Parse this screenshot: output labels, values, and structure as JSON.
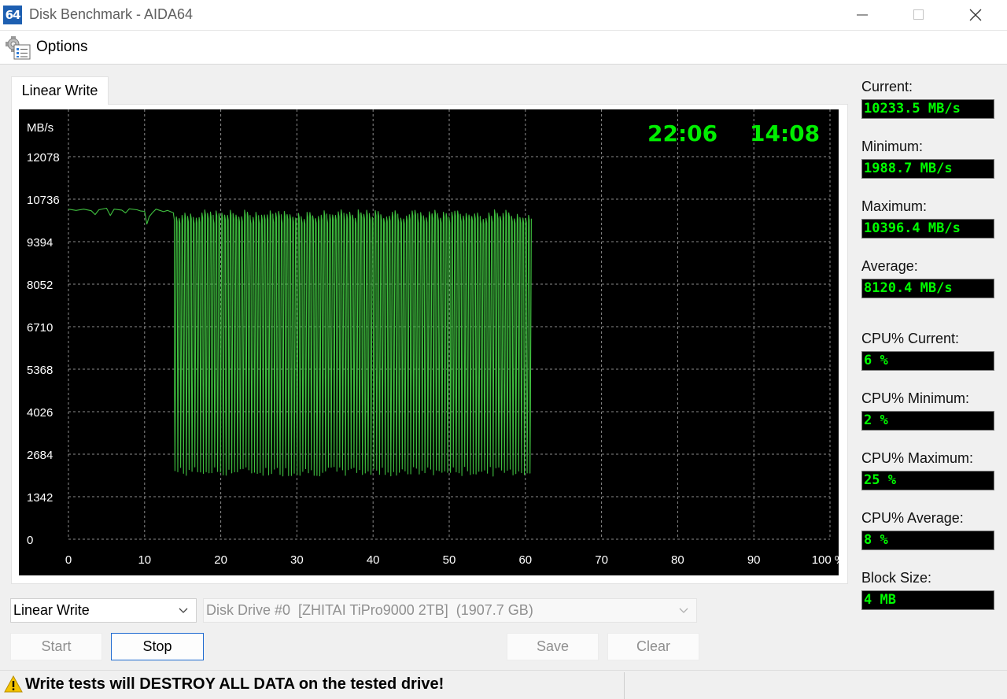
{
  "window": {
    "app_icon_text": "64",
    "title": "Disk Benchmark - AIDA64"
  },
  "menu": {
    "options_label": "Options"
  },
  "tab": {
    "label": "Linear Write"
  },
  "chart_data": {
    "type": "line",
    "ylabel": "MB/s",
    "ylim": [
      0,
      12078
    ],
    "yticks": [
      "0",
      "1342",
      "2684",
      "4026",
      "5368",
      "6710",
      "8052",
      "9394",
      "10736",
      "12078"
    ],
    "xlim": [
      0,
      100
    ],
    "xticks": [
      "0",
      "10",
      "20",
      "30",
      "40",
      "50",
      "60",
      "70",
      "80",
      "90",
      "100 %"
    ],
    "grid": true,
    "colors": {
      "background": "#000000",
      "grid": "#8c8c8c",
      "line": "#3fbf3f",
      "text": "#ffffff",
      "timer": "#00ee00"
    },
    "time_elapsed": "22:06",
    "time_remaining": "14:08",
    "series": [
      {
        "stable_phase": {
          "x": [
            0,
            1,
            2,
            3,
            3.5,
            4,
            5,
            5.5,
            6,
            7,
            7.5,
            8,
            9,
            9.5,
            10,
            10.3,
            10.6,
            11,
            11.5,
            12,
            12.5,
            13,
            13.5,
            13.8
          ],
          "y": [
            10420,
            10380,
            10420,
            10370,
            10250,
            10400,
            10450,
            10220,
            10420,
            10390,
            10300,
            10430,
            10400,
            10360,
            10350,
            9950,
            10180,
            10300,
            10420,
            10380,
            10340,
            10380,
            10330,
            10300
          ]
        },
        "oscillation_phase": {
          "x_start": 13.8,
          "x_end": 60.8,
          "cycles": 126,
          "high": [
            10100,
            10400
          ],
          "low": [
            1988.7,
            2300
          ],
          "mid_plateau": [
            4300,
            8300
          ]
        }
      }
    ]
  },
  "stats": [
    {
      "label": "Current:",
      "value": "10233.5 MB/s"
    },
    {
      "label": "Minimum:",
      "value": "1988.7 MB/s"
    },
    {
      "label": "Maximum:",
      "value": "10396.4 MB/s"
    },
    {
      "label": "Average:",
      "value": "8120.4 MB/s"
    },
    {
      "label": "CPU% Current:",
      "value": "6 %"
    },
    {
      "label": "CPU% Minimum:",
      "value": "2 %"
    },
    {
      "label": "CPU% Maximum:",
      "value": "25 %"
    },
    {
      "label": "CPU% Average:",
      "value": "8 %"
    },
    {
      "label": "Block Size:",
      "value": "4 MB"
    }
  ],
  "controls": {
    "test_select": "Linear Write",
    "drive_select": "Disk Drive #0  [ZHITAI TiPro9000 2TB]  (1907.7 GB)",
    "start_label": "Start",
    "stop_label": "Stop",
    "save_label": "Save",
    "clear_label": "Clear"
  },
  "status": {
    "warning": "Write tests will DESTROY ALL DATA on the tested drive!"
  }
}
